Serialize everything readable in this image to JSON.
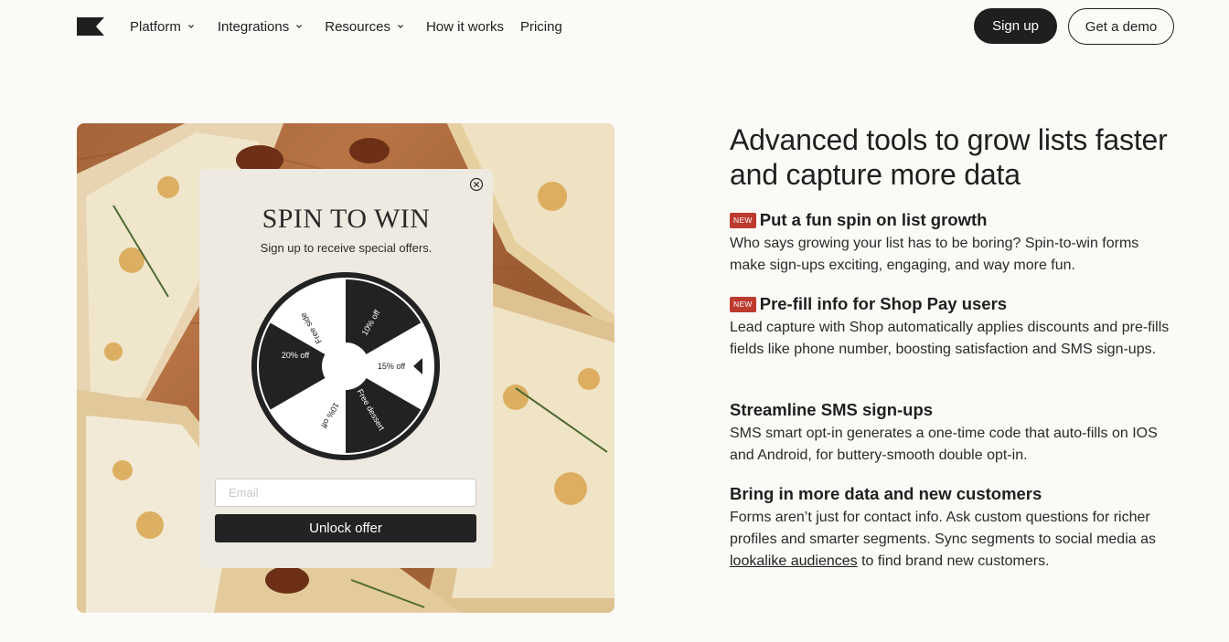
{
  "nav": {
    "logo_icon": "flag-icon",
    "items": [
      {
        "label": "Platform",
        "has_dropdown": true
      },
      {
        "label": "Integrations",
        "has_dropdown": true
      },
      {
        "label": "Resources",
        "has_dropdown": true
      },
      {
        "label": "How it works",
        "has_dropdown": false
      },
      {
        "label": "Pricing",
        "has_dropdown": false
      }
    ],
    "signup_label": "Sign up",
    "demo_label": "Get a demo"
  },
  "popup": {
    "title": "SPIN TO WIN",
    "subtitle": "Sign up to receive special offers.",
    "wheel_segments": [
      "15% off",
      "10% off",
      "Free side",
      "20% off",
      "10% off",
      "Free dessert"
    ],
    "email_placeholder": "Email",
    "button_label": "Unlock offer"
  },
  "content": {
    "headline": "Advanced tools to grow lists faster and capture more data",
    "features": [
      {
        "badge": "NEW",
        "title": "Put a fun spin on list growth",
        "desc": "Who says growing your list has to be boring? Spin-to-win forms make sign-ups exciting, engaging, and way more fun."
      },
      {
        "badge": "NEW",
        "title": "Pre-fill info for Shop Pay users",
        "desc": "Lead capture with Shop automatically applies discounts and pre-fills fields like phone number, boosting satisfaction and SMS sign-ups."
      },
      {
        "badge": "",
        "title": "Streamline SMS sign-ups",
        "desc": "SMS smart opt-in generates a one-time code that auto-fills on IOS and Android, for buttery-smooth double opt-in."
      },
      {
        "badge": "",
        "title": "Bring in more data and new customers",
        "desc_before": "Forms aren’t just for contact info. Ask custom questions for richer profiles and smarter segments. Sync segments to social media as ",
        "link": "lookalike audiences",
        "desc_after": " to find brand new customers."
      }
    ]
  },
  "colors": {
    "background": "#fcfaf7",
    "text": "#1f1f1f",
    "badge": "#bd3a2e",
    "popup_bg": "#efeae1"
  }
}
